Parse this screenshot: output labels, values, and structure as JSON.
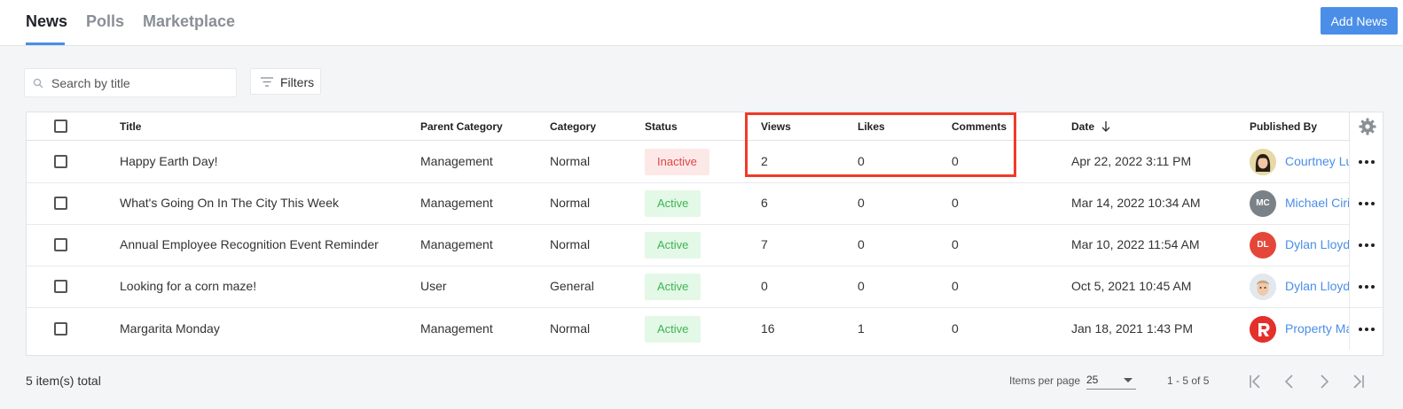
{
  "tabs": [
    {
      "label": "News",
      "active": true
    },
    {
      "label": "Polls",
      "active": false
    },
    {
      "label": "Marketplace",
      "active": false
    }
  ],
  "add_button_label": "Add News",
  "search": {
    "placeholder": "Search by title",
    "value": ""
  },
  "filters_label": "Filters",
  "columns": {
    "title": "Title",
    "parent_category": "Parent Category",
    "category": "Category",
    "status": "Status",
    "views": "Views",
    "likes": "Likes",
    "comments": "Comments",
    "date": "Date",
    "published_by": "Published By"
  },
  "rows": [
    {
      "title": "Happy Earth Day!",
      "parent_category": "Management",
      "category": "Normal",
      "status": "Inactive",
      "views": "2",
      "likes": "0",
      "comments": "0",
      "date": "Apr 22, 2022 3:11 PM",
      "published_by": "Courtney Lu",
      "avatar": {
        "kind": "photo-woman",
        "initials": ""
      }
    },
    {
      "title": "What's Going On In The City This Week",
      "parent_category": "Management",
      "category": "Normal",
      "status": "Active",
      "views": "6",
      "likes": "0",
      "comments": "0",
      "date": "Mar 14, 2022 10:34 AM",
      "published_by": "Michael Ciri",
      "avatar": {
        "kind": "initials",
        "initials": "MC",
        "color": "#7a8288"
      }
    },
    {
      "title": "Annual Employee Recognition Event Reminder",
      "parent_category": "Management",
      "category": "Normal",
      "status": "Active",
      "views": "7",
      "likes": "0",
      "comments": "0",
      "date": "Mar 10, 2022 11:54 AM",
      "published_by": "Dylan Lloyd",
      "avatar": {
        "kind": "initials",
        "initials": "DL",
        "color": "#e4473a"
      }
    },
    {
      "title": "Looking for a corn maze!",
      "parent_category": "User",
      "category": "General",
      "status": "Active",
      "views": "0",
      "likes": "0",
      "comments": "0",
      "date": "Oct 5, 2021 10:45 AM",
      "published_by": "Dylan Lloyd",
      "avatar": {
        "kind": "photo-man",
        "initials": ""
      }
    },
    {
      "title": "Margarita Monday",
      "parent_category": "Management",
      "category": "Normal",
      "status": "Active",
      "views": "16",
      "likes": "1",
      "comments": "0",
      "date": "Jan 18, 2021 1:43 PM",
      "published_by": "Property Ma",
      "avatar": {
        "kind": "logo-r",
        "initials": "",
        "color": "#e4302b"
      }
    }
  ],
  "footer": {
    "total": "5 item(s) total",
    "items_per_page_label": "Items per page",
    "items_per_page_value": "25",
    "range": "1 - 5 of 5"
  },
  "colors": {
    "accent": "#4a8ee8",
    "highlight": "#ef3b27",
    "active": "#3cb553",
    "inactive": "#e04646"
  },
  "icons": [
    "search-icon",
    "filter-icon",
    "sort-arrow-down-icon",
    "gear-icon",
    "more-horizontal-icon",
    "first-page-icon",
    "prev-page-icon",
    "next-page-icon",
    "last-page-icon"
  ]
}
